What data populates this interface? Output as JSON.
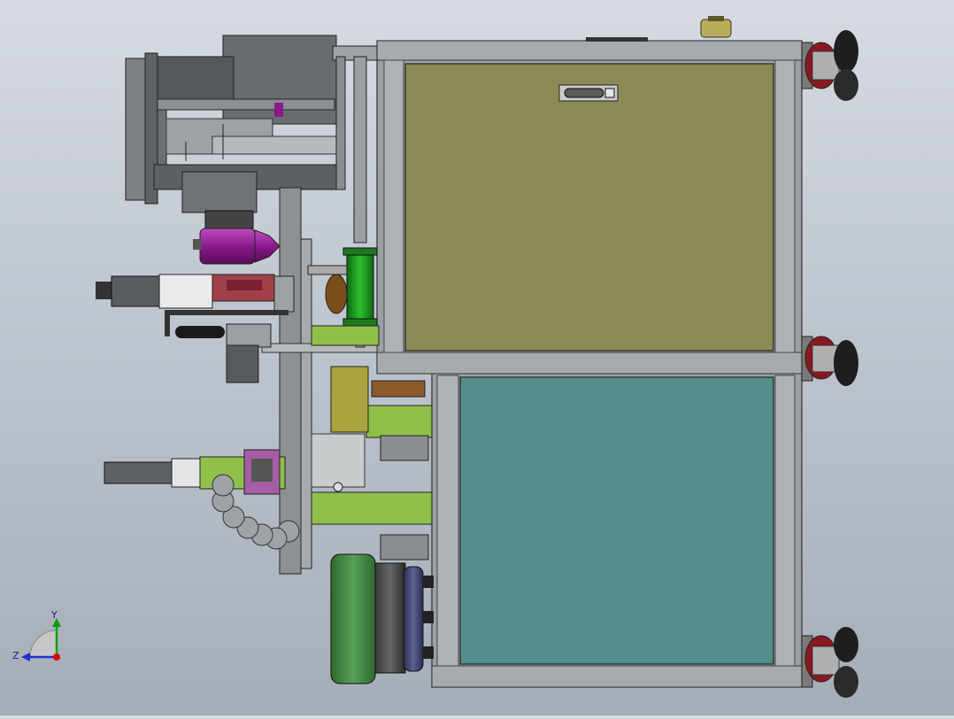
{
  "viewport": {
    "background_top": "#d6dbe2",
    "background_bottom": "#a5adb8"
  },
  "triad": {
    "y_label": "Y",
    "z_label": "Z",
    "y_color": "#00a000",
    "z_color": "#2030d0",
    "origin_color": "#e00000"
  },
  "panels": {
    "upper_color": "#8b8a55",
    "lower_color": "#548e8c",
    "frame_color": "#9da0a3"
  }
}
